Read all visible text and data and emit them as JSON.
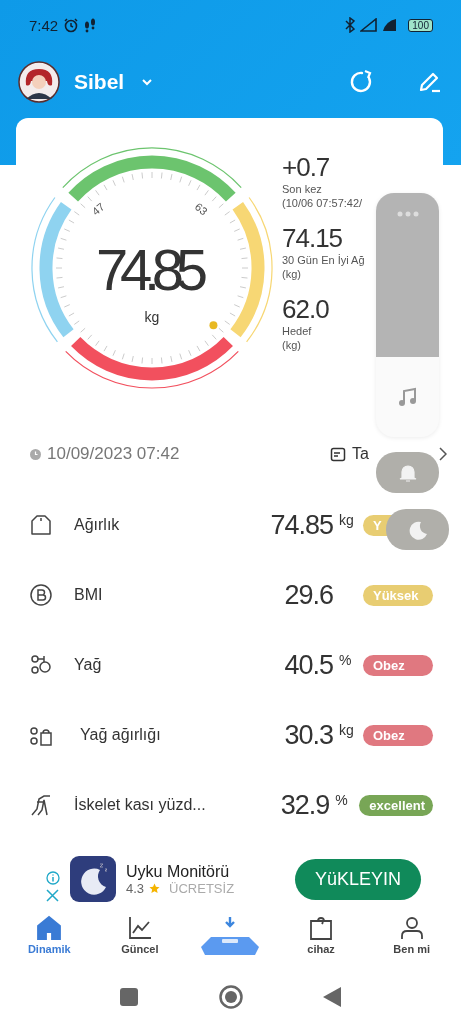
{
  "status_bar": {
    "time": "7:42",
    "battery": "100"
  },
  "header": {
    "user_name": "Sibel"
  },
  "gauge": {
    "value": "74.85",
    "unit": "kg",
    "min_label": "47",
    "max_label": "63"
  },
  "stats": [
    {
      "value": "+0.7",
      "label": "Son kez",
      "sub": "(10/06 07:57:42/"
    },
    {
      "value": "74.15",
      "label": "30 Gün En İyi Ağ",
      "sub": "(kg)"
    },
    {
      "value": "62.0",
      "label": "Hedef",
      "sub": "(kg)"
    }
  ],
  "measure_row": {
    "datetime": "10/09/2023 07:42",
    "history_label": "Ta"
  },
  "metrics": [
    {
      "kind": "weight",
      "name": "Ağırlık",
      "value": "74.85",
      "unit": "kg",
      "badge": "Y",
      "color": "#e8cd72"
    },
    {
      "kind": "bmi",
      "name": "BMI",
      "value": "29.6",
      "badge": "Yüksek",
      "color": "#e8cd72"
    },
    {
      "kind": "fat",
      "name": "Yağ",
      "value": "40.5",
      "unit": "%",
      "badge": "Obez",
      "color": "#e07880"
    },
    {
      "kind": "fat_weight",
      "name": "Yağ ağırlığı",
      "value": "30.3",
      "unit": "kg",
      "badge": "Obez",
      "color": "#e07880"
    },
    {
      "kind": "muscle",
      "name": "İskelet kası yüzd...",
      "value": "32.9",
      "unit": "%",
      "badge": "excellent",
      "color": "#78a656"
    }
  ],
  "ad": {
    "title": "Uyku Monitörü",
    "rating": "4.3",
    "price": "ÜCRETSİZ",
    "button": "YüKLEYIN"
  },
  "tabs": [
    {
      "kind": "home",
      "label": "Dinamik",
      "selected": true
    },
    {
      "kind": "trend",
      "label": "Güncel",
      "selected": false
    },
    {
      "kind": "scale",
      "selected": false
    },
    {
      "kind": "device",
      "label": "cihaz",
      "selected": false
    },
    {
      "kind": "profile",
      "label": "Ben mi",
      "selected": false
    }
  ]
}
